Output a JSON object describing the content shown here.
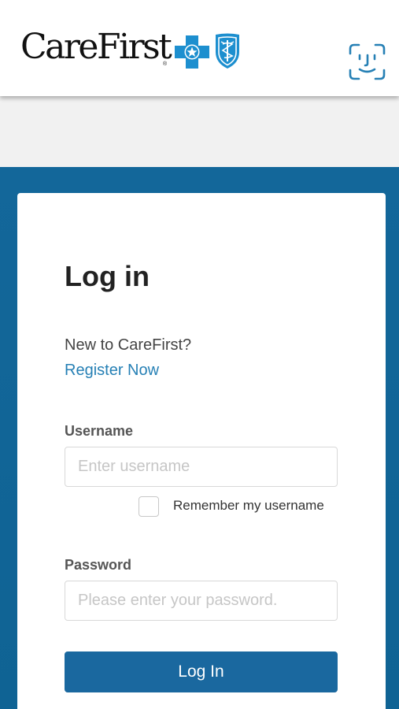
{
  "brand": {
    "name": "CareFirst",
    "registered_mark": "®",
    "cross_color": "#1d8fcf",
    "shield_color": "#1d8fcf",
    "icons": [
      "blue-cross-icon",
      "blue-shield-icon"
    ]
  },
  "header": {
    "faceid_icon": "face-id-icon",
    "accent_color": "#2680b5"
  },
  "login": {
    "title": "Log in",
    "new_prompt": "New to CareFirst?",
    "register_link": "Register Now",
    "username": {
      "label": "Username",
      "placeholder": "Enter username",
      "value": ""
    },
    "remember_label": "Remember my username",
    "remember_checked": false,
    "password": {
      "label": "Password",
      "placeholder": "Please enter your password.",
      "value": ""
    },
    "submit_label": "Log In",
    "button_color": "#1a689f",
    "background_color": "#13679a"
  }
}
